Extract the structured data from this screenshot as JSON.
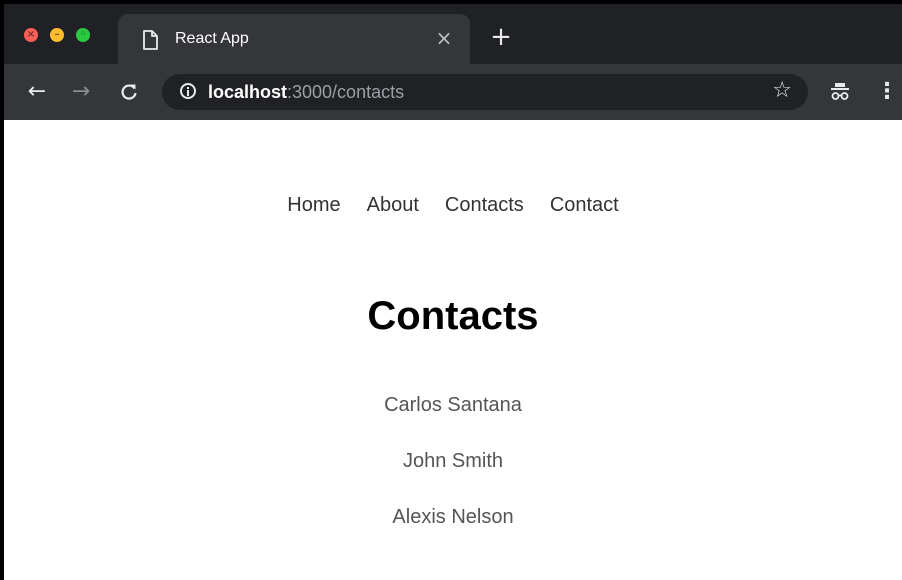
{
  "browser": {
    "tab": {
      "title": "React App",
      "close": "×"
    },
    "new_tab": "+",
    "nav": {
      "back": "←",
      "forward": "→",
      "reload": "C"
    },
    "url": {
      "host": "localhost",
      "rest": ":3000/contacts"
    },
    "star": "☆",
    "menu": "⋮"
  },
  "page": {
    "nav": [
      "Home",
      "About",
      "Contacts",
      "Contact"
    ],
    "title": "Contacts",
    "contacts": [
      "Carlos Santana",
      "John Smith",
      "Alexis Nelson"
    ]
  },
  "colors": {
    "tabstrip": "#202124",
    "toolbar": "#35363a",
    "close": "#fc5f57",
    "minimize": "#fdbc2e",
    "maximize": "#29c940"
  }
}
